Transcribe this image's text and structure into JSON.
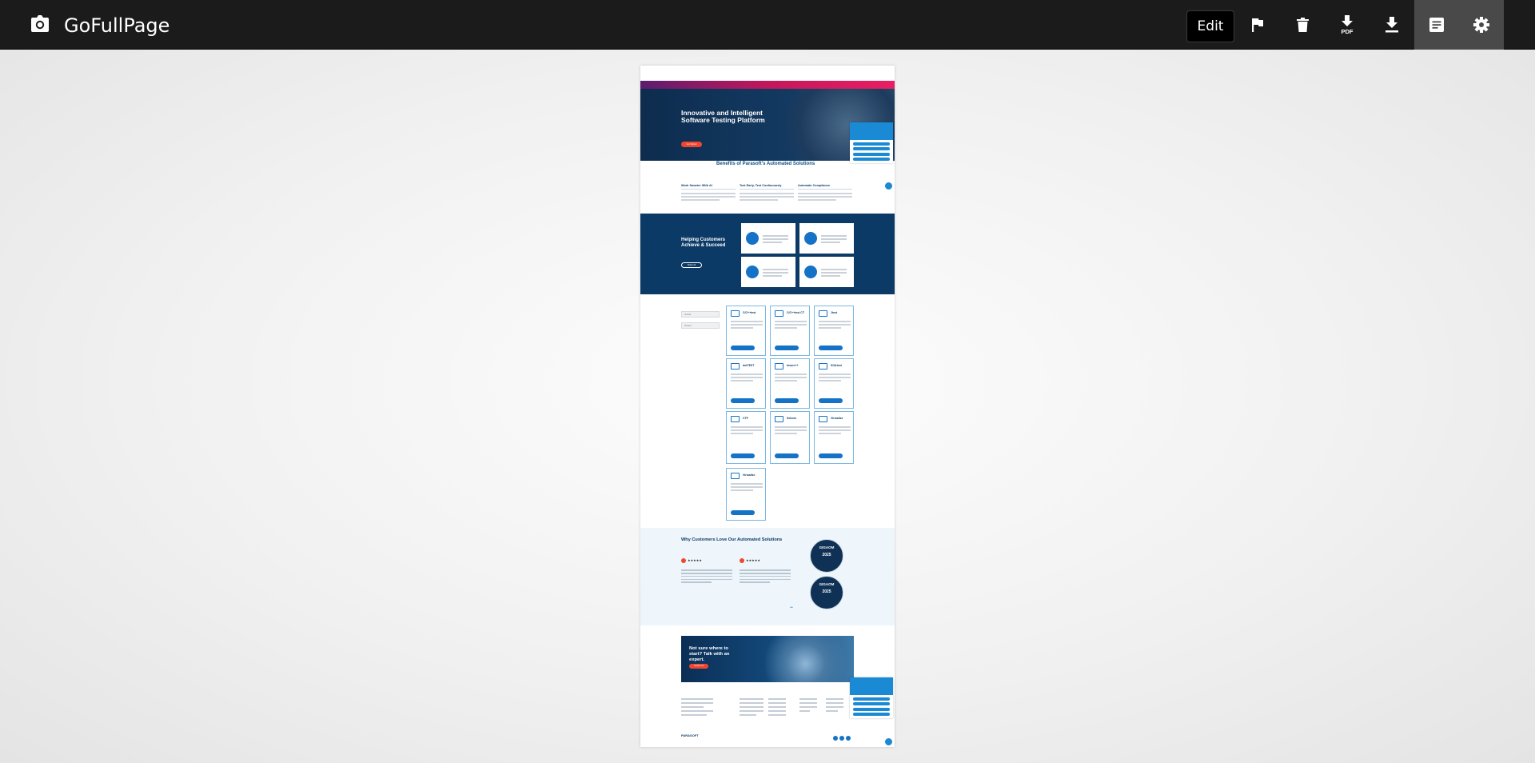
{
  "toolbar": {
    "app_title": "GoFullPage",
    "edit_label": "Edit"
  },
  "icons": {
    "camera": "camera-icon",
    "flag": "flag-icon",
    "delete": "trash-icon",
    "pdf": "download-pdf-icon",
    "download": "download-icon",
    "notes": "document-icon",
    "settings": "gear-icon"
  },
  "colors": {
    "toolbar_bg": "#1b1b1b",
    "active_button_bg": "#494949",
    "brand_blue": "#0b3a66",
    "accent_orange": "#ef4630"
  },
  "screenshot": {
    "hero": {
      "title": "Innovative and Intelligent Software Testing Platform",
      "button": "Get Started"
    },
    "benefits": {
      "title": "Benefits of Parasoft's Automated Solutions",
      "items": [
        "Work Smarter With AI",
        "Test Early, Test Continuously",
        "Automate Compliance"
      ]
    },
    "helping": {
      "title": "Helping Customers Achieve & Succeed",
      "button": "Watch All"
    },
    "filters": [
      "Vertical",
      "Product"
    ],
    "products": [
      "C/C++test",
      "C/C++test CT",
      "Jtest",
      "dotTEST",
      "Insure++",
      "SOAtest",
      "CTP",
      "Selenic",
      "Virtualize",
      "Virtualize"
    ],
    "love": {
      "title": "Why Customers Love Our Automated Solutions",
      "badges": [
        {
          "name": "GIGAOM",
          "year": "2025"
        },
        {
          "name": "GIGAOM",
          "year": "2025"
        }
      ]
    },
    "cta": {
      "title": "Not sure where to start? Talk with an expert.",
      "button": "Contact Us"
    },
    "footer": {
      "logo": "PARASOFT"
    }
  }
}
